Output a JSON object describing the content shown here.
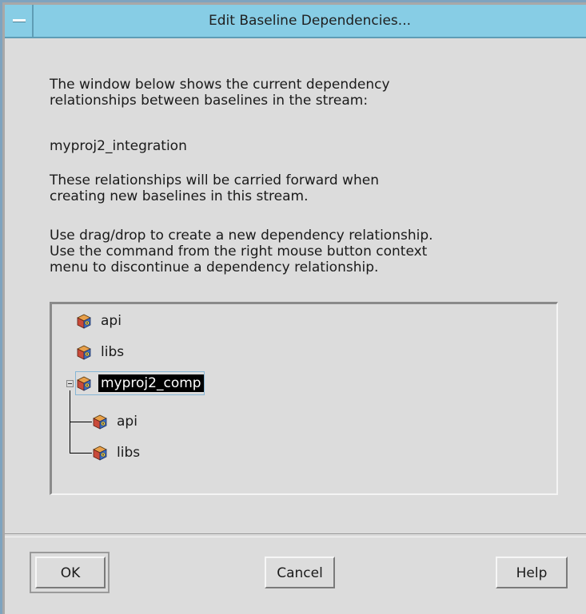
{
  "window": {
    "title": "Edit Baseline Dependencies..."
  },
  "content": {
    "intro": "The window below shows the current dependency\nrelationships between baselines in the stream:",
    "stream_name": "myproj2_integration",
    "carry_note": "These relationships will be carried forward when\ncreating new baselines in this stream.",
    "instructions": "Use drag/drop to create a new dependency relationship.\nUse the command from the right mouse button context\nmenu to discontinue a dependency relationship."
  },
  "tree": {
    "nodes": [
      {
        "label": "api",
        "icon": "component-cube-icon",
        "depth": 0,
        "selected": false
      },
      {
        "label": "libs",
        "icon": "component-cube-icon",
        "depth": 0,
        "selected": false
      },
      {
        "label": "myproj2_comp",
        "icon": "component-cube-icon",
        "depth": 0,
        "selected": true,
        "expanded": true
      },
      {
        "label": "api",
        "icon": "component-cube-icon",
        "depth": 1,
        "selected": false
      },
      {
        "label": "libs",
        "icon": "component-cube-icon",
        "depth": 1,
        "selected": false
      }
    ]
  },
  "buttons": {
    "ok": "OK",
    "cancel": "Cancel",
    "help": "Help"
  },
  "colors": {
    "titlebar": "#87cde5",
    "dialog_bg": "#dcdcdc",
    "selection_bg": "#000000"
  }
}
